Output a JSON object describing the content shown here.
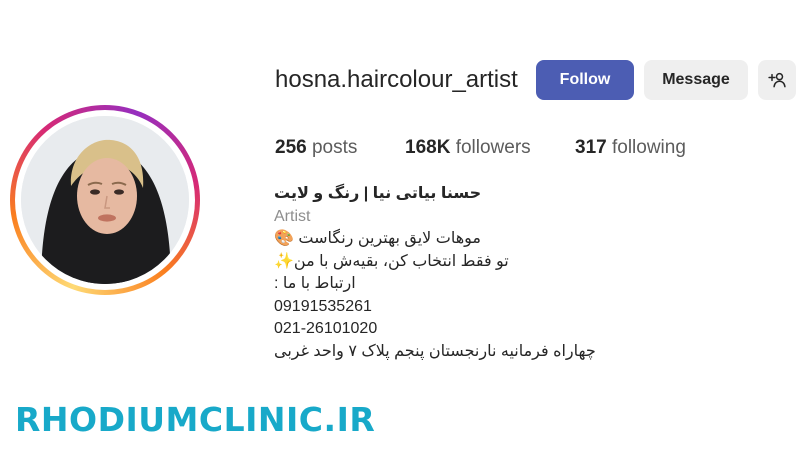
{
  "profile": {
    "username": "hosna.haircolour_artist",
    "avatar_icon": "profile-photo",
    "buttons": {
      "follow": "Follow",
      "message": "Message",
      "add_user_icon": "add-user-icon"
    },
    "stats": {
      "posts_count": "256",
      "posts_label": "posts",
      "followers_count": "168K",
      "followers_label": "followers",
      "following_count": "317",
      "following_label": "following"
    },
    "bio": {
      "full_name": "حسنا بیاتی نیا | رنگ و لایت",
      "category": "Artist",
      "lines": [
        "موهات لایق بهترین رنگاست 🎨",
        "تو فقط انتخاب کن، بقیه‌ش با من✨",
        "ارتباط با ما :",
        "09191535261",
        "021-26101020",
        "چهاراه فرمانیه نارنجستان پنجم پلاک ۷ واحد غربی"
      ]
    }
  },
  "watermark": "RHODIUMCLINIC.IR",
  "colors": {
    "follow_button": "#4c5db3",
    "secondary_button": "#efefef",
    "watermark": "#18a9c9"
  }
}
